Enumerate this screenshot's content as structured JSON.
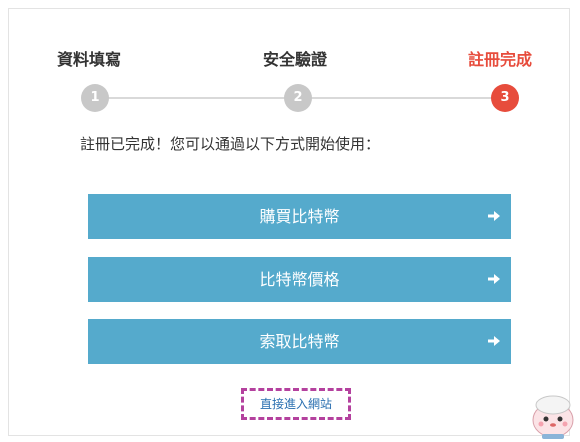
{
  "steps": [
    {
      "label": "資料填寫",
      "number": "1",
      "state": "done"
    },
    {
      "label": "安全驗證",
      "number": "2",
      "state": "done"
    },
    {
      "label": "註冊完成",
      "number": "3",
      "state": "current"
    }
  ],
  "message": "註冊已完成！您可以通過以下方式開始使用：",
  "actions": [
    {
      "label": "購買比特幣",
      "icon": "arrow-right-icon"
    },
    {
      "label": "比特幣價格",
      "icon": "arrow-right-icon"
    },
    {
      "label": "索取比特幣",
      "icon": "arrow-right-icon"
    }
  ],
  "direct_link": "直接進入網站",
  "colors": {
    "accent_active": "#e74c3c",
    "step_inactive": "#c8c8c8",
    "button": "#55aacc",
    "link": "#2a6fb0",
    "link_border": "#b4419e"
  },
  "watermark": {
    "icon": "mascot-icon"
  }
}
